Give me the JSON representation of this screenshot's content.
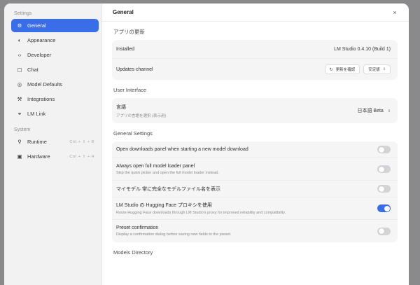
{
  "sidebar": {
    "settings_heading": "Settings",
    "system_heading": "System",
    "items": [
      {
        "label": "General",
        "icon": "gear-icon",
        "glyph": "⚙",
        "active": true
      },
      {
        "label": "Appearance",
        "icon": "palette-icon",
        "glyph": "◐"
      },
      {
        "label": "Developer",
        "icon": "code-icon",
        "glyph": "‹›"
      },
      {
        "label": "Chat",
        "icon": "chat-icon",
        "glyph": "▢"
      },
      {
        "label": "Model Defaults",
        "icon": "model-icon",
        "glyph": "◎"
      },
      {
        "label": "Integrations",
        "icon": "wrench-icon",
        "glyph": "⚒"
      },
      {
        "label": "LM Link",
        "icon": "link-icon",
        "glyph": "⚭"
      }
    ],
    "system_items": [
      {
        "label": "Runtime",
        "icon": "runtime-icon",
        "glyph": "⚲",
        "shortcut": "Ctrl + ⇧ + R"
      },
      {
        "label": "Hardware",
        "icon": "hardware-icon",
        "glyph": "▣",
        "shortcut": "Ctrl + ⇧ + H"
      }
    ]
  },
  "header": {
    "title": "General",
    "close_glyph": "×"
  },
  "app_updates": {
    "section_title": "アプリの更新",
    "installed_label": "Installed",
    "installed_value": "LM Studio 0.4.10 (Build 1)",
    "channel_label": "Updates channel",
    "check_button": "更新を確認",
    "channel_value": "安定版"
  },
  "ui": {
    "section_title": "User Interface",
    "language_label": "言語",
    "language_desc": "アプリの言語を選択 (表示用)",
    "language_value": "日本語 Beta"
  },
  "general": {
    "section_title": "General Settings",
    "settings": [
      {
        "label": "Open downloads panel when starting a new model download",
        "desc": "",
        "on": false
      },
      {
        "label": "Always open full model loader panel",
        "desc": "Skip the quick picker and open the full model loader instead.",
        "on": false
      },
      {
        "label": "マイモデル 常に完全なモデルファイル名を表示",
        "desc": "",
        "on": false
      },
      {
        "label": "LM Studio の Hugging Face プロキシを使用",
        "desc": "Route Hugging Face downloads through LM Studio's proxy for improved reliability and compatibility.",
        "on": true
      },
      {
        "label": "Preset confirmation",
        "desc": "Display a confirmation dialog before saving new fields to the preset.",
        "on": false
      }
    ]
  },
  "models_dir": {
    "section_title": "Models Directory"
  },
  "colors": {
    "accent": "#3a6ee8",
    "sidebar_bg": "#f2f2f3",
    "card_bg": "#f5f5f6"
  }
}
